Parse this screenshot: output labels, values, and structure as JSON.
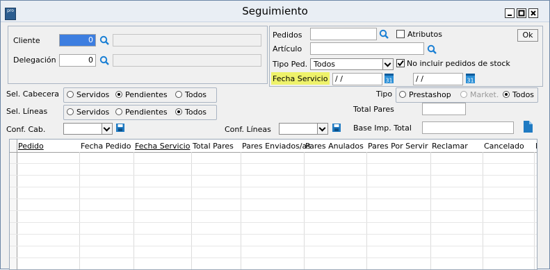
{
  "window": {
    "app_icon_text": "pro",
    "title": "Seguimiento"
  },
  "filters": {
    "cliente": {
      "label": "Cliente",
      "value": "0"
    },
    "delegacion": {
      "label": "Delegación",
      "value": "0"
    },
    "pedidos": {
      "label": "Pedidos",
      "value": ""
    },
    "atributos": {
      "label": "Atributos",
      "checked": false
    },
    "ok_label": "Ok",
    "articulo": {
      "label": "Artículo",
      "value": ""
    },
    "tipo_ped": {
      "label": "Tipo Ped.",
      "value": "Todos"
    },
    "no_incluir": {
      "label": "No incluir pedidos de stock",
      "checked": true
    },
    "fecha_servicio": {
      "label": "Fecha Servicio",
      "from": "/ /",
      "to": "/ /",
      "highlight_color": "#eef26b"
    }
  },
  "sel_cabecera": {
    "label": "Sel. Cabecera",
    "options": [
      "Servidos",
      "Pendientes",
      "Todos"
    ],
    "selected": "Pendientes"
  },
  "sel_lineas": {
    "label": "Sel. Líneas",
    "options": [
      "Servidos",
      "Pendientes",
      "Todos"
    ],
    "selected": "Todos"
  },
  "tipo": {
    "label": "Tipo",
    "options": [
      "Prestashop",
      "Market.",
      "Todos"
    ],
    "selected": "Todos",
    "disabled": "Market."
  },
  "total_pares": {
    "label": "Total Pares",
    "value": ""
  },
  "conf_cab": {
    "label": "Conf. Cab.",
    "value": ""
  },
  "conf_lineas": {
    "label": "Conf. Líneas",
    "value": ""
  },
  "base_imp": {
    "label": "Base Imp. Total",
    "value": ""
  },
  "grid": {
    "columns": [
      "Pedido",
      "Fecha Pedido",
      "Fecha Servicio",
      "Total Pares",
      "Pares Enviados/as",
      "Pares Anulados",
      "Pares Por Servir",
      "Reclamar",
      "Cancelado",
      "I"
    ]
  },
  "colors": {
    "accent": "#1a7fd4",
    "title_bg": "#e9eef4",
    "window_bg": "#f0f0f0"
  },
  "icons": [
    "search-icon",
    "calendar-icon",
    "floppy-disk-icon",
    "document-icon",
    "minimize-icon",
    "maximize-icon",
    "close-icon"
  ]
}
